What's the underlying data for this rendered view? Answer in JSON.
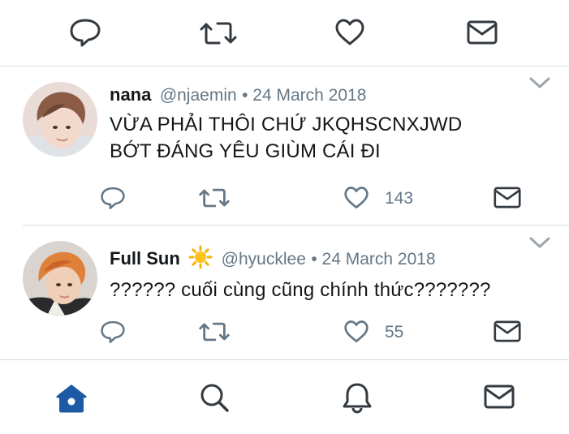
{
  "colors": {
    "accent": "#1c5aa6",
    "icon_gray": "#657786",
    "icon_dark": "#333a40",
    "divider": "#d6dadd"
  },
  "top_actions": {
    "icons": [
      "reply-icon",
      "retweet-icon",
      "like-icon",
      "message-icon"
    ]
  },
  "tweets": [
    {
      "name": "nana",
      "handle": "@njaemin",
      "date": "• 24 March 2018",
      "text_line1": "VỪA PHẢI THÔI CHỨ JKQHSCNXJWD",
      "text_line2": "BỚT ĐÁNG YÊU GIÙM CÁI ĐI",
      "likes": "143"
    },
    {
      "name": "Full Sun",
      "name_emoji": "sun-emoji",
      "handle": "@hyucklee",
      "date": "• 24 March 2018",
      "text_line1": "?????? cuối cùng cũng chính thức???????",
      "likes": "55"
    }
  ],
  "bottom_nav": {
    "items": [
      "home-icon",
      "search-icon",
      "notifications-icon",
      "messages-icon"
    ],
    "active": "home-icon"
  }
}
